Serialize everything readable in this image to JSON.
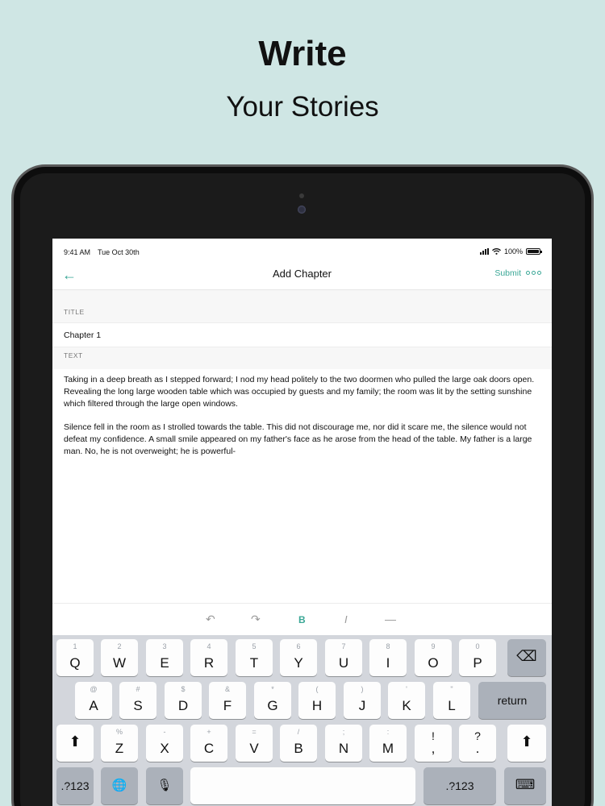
{
  "marketing": {
    "headline": "Write",
    "subheadline": "Your Stories"
  },
  "status_bar": {
    "time": "9:41 AM",
    "date": "Tue Oct 30th",
    "battery": "100%"
  },
  "nav": {
    "back_icon": "←",
    "title": "Add Chapter",
    "submit_label": "Submit"
  },
  "form": {
    "title_label": "TITLE",
    "title_value": "Chapter 1",
    "text_label": "TEXT",
    "paragraphs": [
      "Taking in a deep breath as I stepped forward; I nod my head politely to the two doormen who pulled the large oak doors open. Revealing the long large wooden table which was occupied by guests and my family; the room was lit by the setting sunshine which filtered through the large open windows.",
      "Silence fell in the room as I strolled towards the table. This did not discourage me, nor did it scare me, the silence would not defeat my confidence. A small smile appeared on my father's face as he arose from the head of the table. My father is a large man. No, he is not overweight; he is powerful-"
    ]
  },
  "format_bar": {
    "undo_icon": "↶",
    "redo_icon": "↷",
    "bold_label": "B",
    "italic_label": "I",
    "rule_icon": "—"
  },
  "keyboard": {
    "row1": [
      {
        "sub": "1",
        "main": "Q"
      },
      {
        "sub": "2",
        "main": "W"
      },
      {
        "sub": "3",
        "main": "E"
      },
      {
        "sub": "4",
        "main": "R"
      },
      {
        "sub": "5",
        "main": "T"
      },
      {
        "sub": "6",
        "main": "Y"
      },
      {
        "sub": "7",
        "main": "U"
      },
      {
        "sub": "8",
        "main": "I"
      },
      {
        "sub": "9",
        "main": "O"
      },
      {
        "sub": "0",
        "main": "P"
      }
    ],
    "row2": [
      {
        "sub": "@",
        "main": "A"
      },
      {
        "sub": "#",
        "main": "S"
      },
      {
        "sub": "$",
        "main": "D"
      },
      {
        "sub": "&",
        "main": "F"
      },
      {
        "sub": "*",
        "main": "G"
      },
      {
        "sub": "(",
        "main": "H"
      },
      {
        "sub": ")",
        "main": "J"
      },
      {
        "sub": "'",
        "main": "K"
      },
      {
        "sub": "\"",
        "main": "L"
      }
    ],
    "row3": [
      {
        "sub": "%",
        "main": "Z"
      },
      {
        "sub": "-",
        "main": "X"
      },
      {
        "sub": "+",
        "main": "C"
      },
      {
        "sub": "=",
        "main": "V"
      },
      {
        "sub": "/",
        "main": "B"
      },
      {
        "sub": ";",
        "main": "N"
      },
      {
        "sub": ":",
        "main": "M"
      },
      {
        "sub": "!",
        "main": ","
      },
      {
        "sub": "?",
        "main": "."
      }
    ],
    "return_label": "return",
    "numbers_label": ".?123",
    "backspace_icon": "⌫",
    "shift_icon": "⬆",
    "globe_icon": "🌐",
    "mic_icon": "🎙",
    "keyboard_hide_icon": "⌨"
  }
}
